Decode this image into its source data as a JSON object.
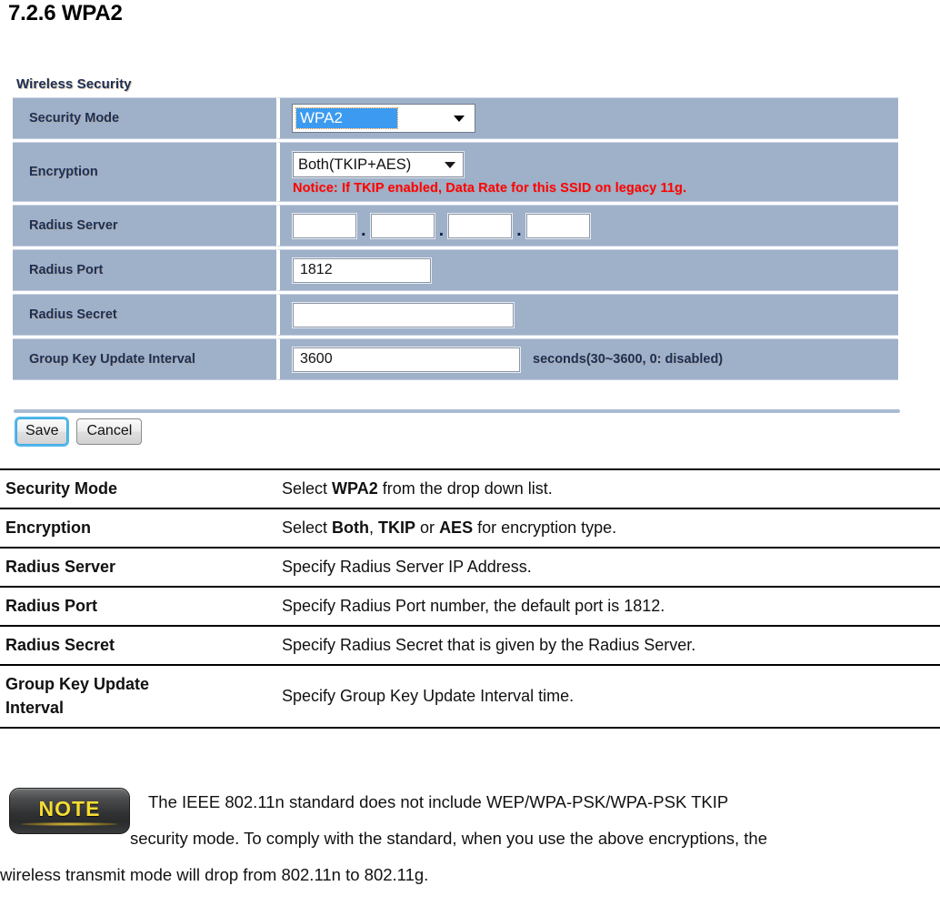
{
  "heading": "7.2.6 WPA2",
  "panel": {
    "title": "Wireless Security",
    "rows": [
      {
        "label": "Security Mode",
        "control": "select",
        "value": "WPA2"
      },
      {
        "label": "Encryption",
        "control": "select",
        "value": "Both(TKIP+AES)",
        "notice": "Notice: If TKIP enabled, Data Rate for this SSID on legacy 11g."
      },
      {
        "label": "Radius Server",
        "control": "ip",
        "octets": [
          "",
          "",
          "",
          ""
        ],
        "separator": "."
      },
      {
        "label": "Radius Port",
        "control": "text",
        "value": "1812"
      },
      {
        "label": "Radius Secret",
        "control": "text",
        "value": ""
      },
      {
        "label": "Group Key Update Interval",
        "control": "text",
        "value": "3600",
        "suffix": "seconds(30~3600, 0: disabled)"
      }
    ],
    "buttons": {
      "save": "Save",
      "cancel": "Cancel"
    }
  },
  "description": {
    "rows": [
      {
        "term": "Security Mode",
        "term_line2": "",
        "desc_parts": [
          {
            "t": "Select ",
            "b": false
          },
          {
            "t": "WPA2",
            "b": true
          },
          {
            "t": " from the drop down list.",
            "b": false
          }
        ]
      },
      {
        "term": "Encryption",
        "term_line2": "",
        "desc_parts": [
          {
            "t": "Select ",
            "b": false
          },
          {
            "t": "Both",
            "b": true
          },
          {
            "t": ", ",
            "b": false
          },
          {
            "t": "TKIP",
            "b": true
          },
          {
            "t": " or ",
            "b": false
          },
          {
            "t": "AES",
            "b": true
          },
          {
            "t": " for encryption type.",
            "b": false
          }
        ]
      },
      {
        "term": "Radius Server",
        "term_line2": "",
        "desc_parts": [
          {
            "t": "Specify Radius Server IP Address.",
            "b": false
          }
        ]
      },
      {
        "term": "Radius Port",
        "term_line2": "",
        "desc_parts": [
          {
            "t": "Specify Radius Port number, the default port is 1812.",
            "b": false
          }
        ]
      },
      {
        "term": "Radius Secret",
        "term_line2": "",
        "desc_parts": [
          {
            "t": "Specify Radius Secret that is given by the Radius Server.",
            "b": false
          }
        ]
      },
      {
        "term": "Group Key Update",
        "term_line2": "Interval",
        "desc_parts": [
          {
            "t": "Specify Group Key Update Interval time.",
            "b": false
          }
        ]
      }
    ]
  },
  "note": {
    "badge_label": "NOTE",
    "line1": "The IEEE 802.11n standard does not include WEP/WPA-PSK/WPA-PSK TKIP",
    "line2": "security mode. To comply with the standard, when you use the above encryptions, the",
    "line3": "wireless transmit mode will drop from 802.11n to 802.11g."
  },
  "colors": {
    "row_bg": "#9fb0c9",
    "label_text": "#1b2f54",
    "notice_red": "#ff0000",
    "select_highlight": "#3c9bf0",
    "note_yellow": "#f5dc33",
    "rule": "#a9bbd2"
  }
}
